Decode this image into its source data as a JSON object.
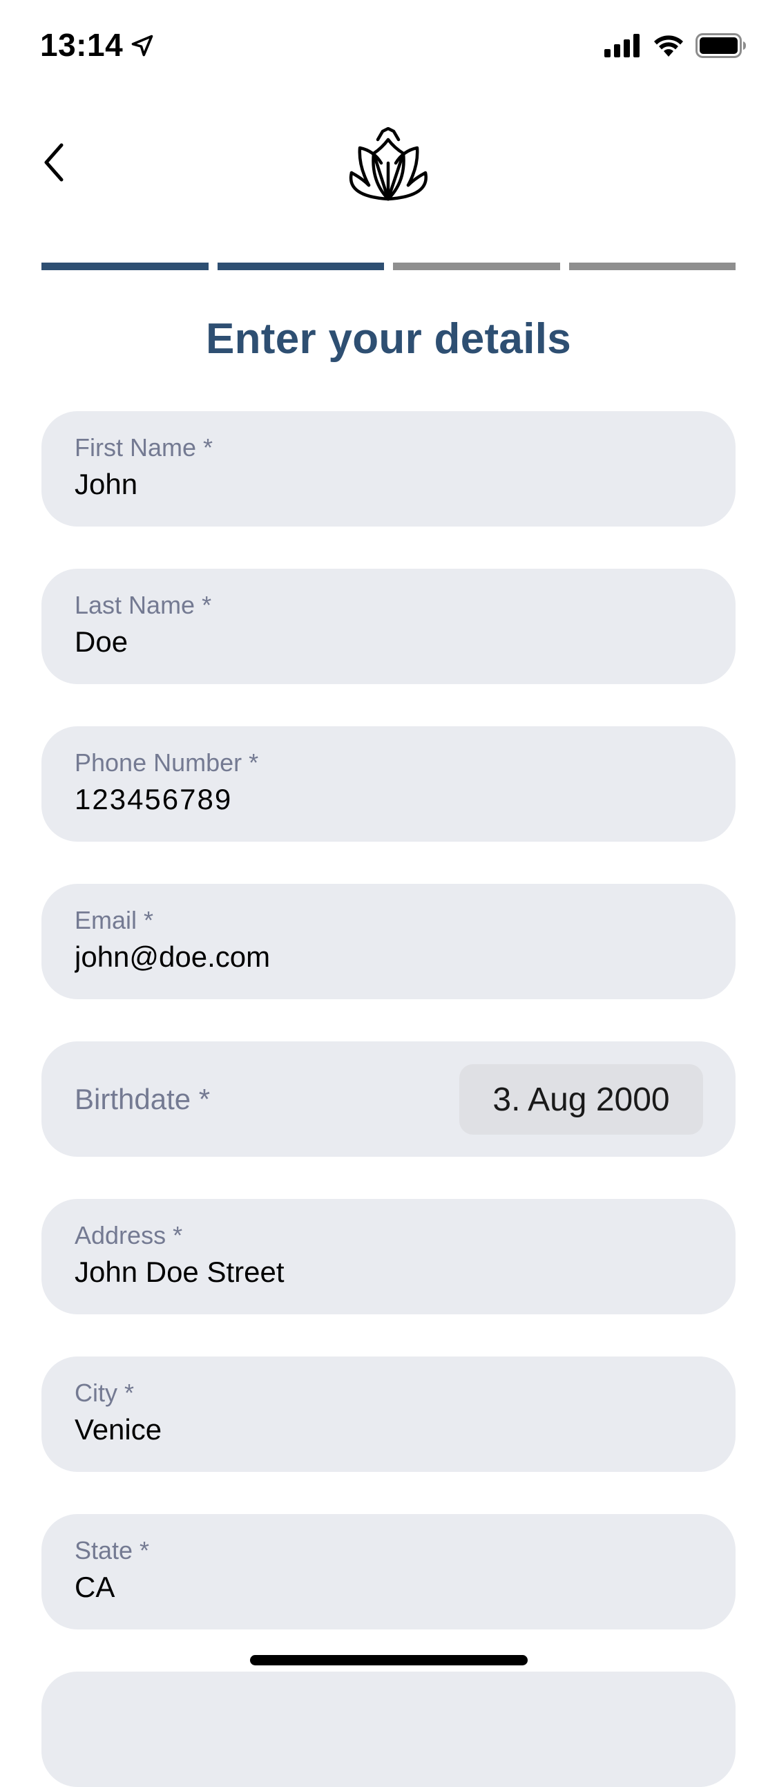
{
  "status_bar": {
    "time": "13:14",
    "icons": [
      "location-arrow-icon",
      "cellular-signal-icon",
      "wifi-icon",
      "battery-icon"
    ]
  },
  "nav": {
    "back_icon": "chevron-left-icon",
    "logo_icon": "lotus-logo-icon"
  },
  "progress": {
    "total_steps": 4,
    "completed_steps": 2,
    "active_color": "#2e4f72",
    "inactive_color": "#8f8f8f"
  },
  "title": "Enter your details",
  "fields": {
    "first_name": {
      "label": "First Name *",
      "value": "John"
    },
    "last_name": {
      "label": "Last Name *",
      "value": "Doe"
    },
    "phone": {
      "label": "Phone Number  *",
      "value": "123456789"
    },
    "email": {
      "label": "Email  *",
      "value": "john@doe.com"
    },
    "birthdate": {
      "label": "Birthdate  *",
      "value": "3. Aug 2000"
    },
    "address": {
      "label": "Address *",
      "value": "John Doe Street"
    },
    "city": {
      "label": "City *",
      "value": "Venice"
    },
    "state": {
      "label": "State *",
      "value": "CA"
    }
  },
  "colors": {
    "accent": "#2e4f72",
    "field_background": "#e9ebf0",
    "label": "#747a92"
  }
}
